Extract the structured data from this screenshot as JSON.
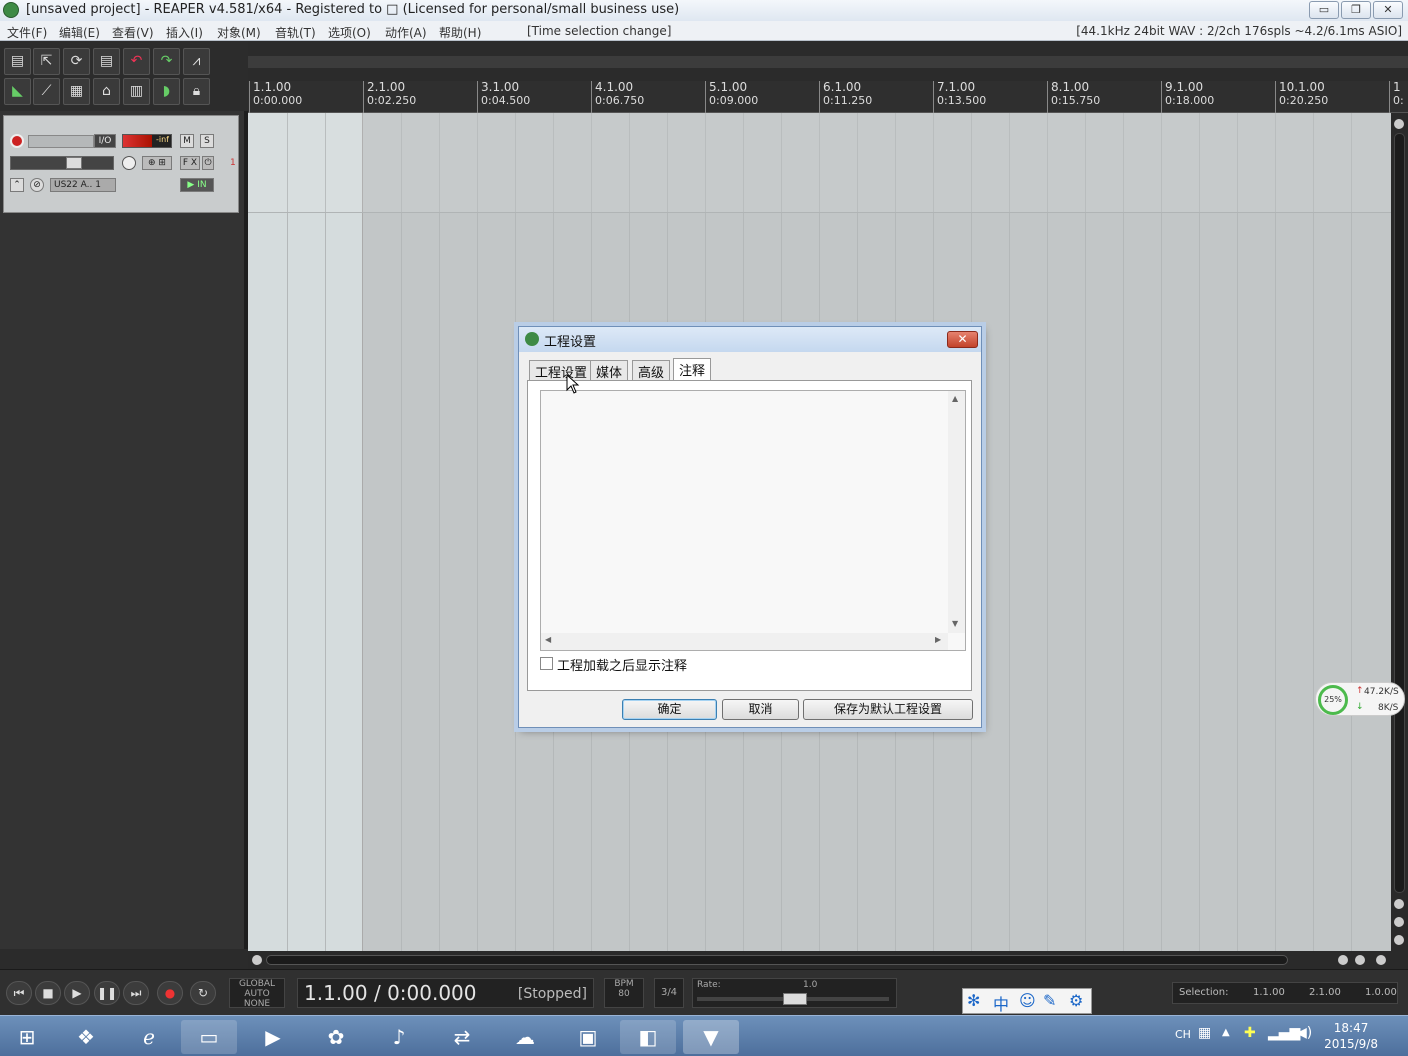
{
  "window": {
    "title": "[unsaved project] - REAPER v4.581/x64 - Registered to □ (Licensed for personal/small business use)",
    "minimize": "▭",
    "maximize": "❐",
    "close": "✕"
  },
  "menu": {
    "items": [
      "文件(F)",
      "编辑(E)",
      "查看(V)",
      "插入(I)",
      "对象(M)",
      "音轨(T)",
      "选项(O)",
      "动作(A)",
      "帮助(H)"
    ],
    "status": "[Time selection change]",
    "audio_info": "[44.1kHz 24bit WAV : 2/2ch 176spls ~4.2/6.1ms ASIO]"
  },
  "track": {
    "io_label": "I/O",
    "mute": "M",
    "solo": "S",
    "fx": "F X",
    "number": "1",
    "input": "US22 A.. 1",
    "meter_value": "-inf"
  },
  "ruler": {
    "marks": [
      {
        "bar": "1.1.00",
        "time": "0:00.000"
      },
      {
        "bar": "2.1.00",
        "time": "0:02.250"
      },
      {
        "bar": "3.1.00",
        "time": "0:04.500"
      },
      {
        "bar": "4.1.00",
        "time": "0:06.750"
      },
      {
        "bar": "5.1.00",
        "time": "0:09.000"
      },
      {
        "bar": "6.1.00",
        "time": "0:11.250"
      },
      {
        "bar": "7.1.00",
        "time": "0:13.500"
      },
      {
        "bar": "8.1.00",
        "time": "0:15.750"
      },
      {
        "bar": "9.1.00",
        "time": "0:18.000"
      },
      {
        "bar": "10.1.00",
        "time": "0:20.250"
      },
      {
        "bar": "1",
        "time": "0:"
      }
    ]
  },
  "transport": {
    "timecode": "1.1.00 / 0:00.000",
    "state": "[Stopped]",
    "global_auto": "GLOBAL AUTO",
    "auto_mode": "NONE",
    "bpm_label": "BPM",
    "bpm": "80",
    "time_sig": "3/4",
    "rate_label": "Rate:",
    "rate": "1.0",
    "selection_label": "Selection:",
    "sel_start": "1.1.00",
    "sel_end": "2.1.00",
    "sel_len": "1.0.00"
  },
  "dialog": {
    "title": "工程设置",
    "close": "✕",
    "tabs": [
      "工程设置",
      "媒体",
      "高级",
      "注释"
    ],
    "active_tab": "注释",
    "notes_text": "",
    "checkbox_label": "工程加载之后显示注释",
    "ok": "确定",
    "cancel": "取消",
    "save_default": "保存为默认工程设置"
  },
  "netmon": {
    "percent": "25%",
    "up": "47.2K/S",
    "down": "8K/S"
  },
  "ime": {
    "lang": "中"
  },
  "taskbar": {
    "lang": "CH",
    "time": "18:47",
    "date": "2015/9/8"
  },
  "colors": {
    "arrange_bg": "#c2c6c7",
    "selection": "#d5dcdd",
    "dialog_close": "#c2432b"
  }
}
